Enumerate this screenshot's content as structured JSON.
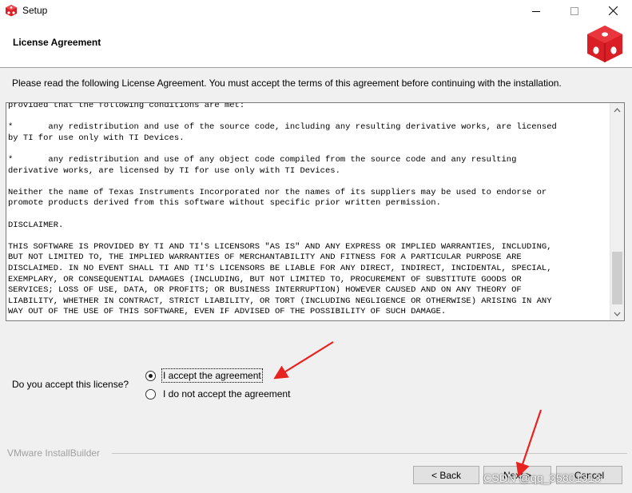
{
  "window": {
    "title": "Setup",
    "controls": {
      "minimize": "minimize-icon",
      "maximize": "maximize-icon",
      "close": "close-icon"
    }
  },
  "header": {
    "title": "License Agreement",
    "logo": "installer-box-logo"
  },
  "instruction": "Please read the following License Agreement. You must accept the terms of this agreement before continuing with the installation.",
  "license": {
    "lines": [
      "provided that the following conditions are met:",
      "",
      "*       any redistribution and use of the source code, including any resulting derivative works, are licensed",
      "by TI for use only with TI Devices.",
      "",
      "*       any redistribution and use of any object code compiled from the source code and any resulting",
      "derivative works, are licensed by TI for use only with TI Devices.",
      "",
      "Neither the name of Texas Instruments Incorporated nor the names of its suppliers may be used to endorse or",
      "promote products derived from this software without specific prior written permission.",
      "",
      "DISCLAIMER.",
      "",
      "THIS SOFTWARE IS PROVIDED BY TI AND TI'S LICENSORS \"AS IS\" AND ANY EXPRESS OR IMPLIED WARRANTIES, INCLUDING,",
      "BUT NOT LIMITED TO, THE IMPLIED WARRANTIES OF MERCHANTABILITY AND FITNESS FOR A PARTICULAR PURPOSE ARE",
      "DISCLAIMED. IN NO EVENT SHALL TI AND TI'S LICENSORS BE LIABLE FOR ANY DIRECT, INDIRECT, INCIDENTAL, SPECIAL,",
      "EXEMPLARY, OR CONSEQUENTIAL DAMAGES (INCLUDING, BUT NOT LIMITED TO, PROCUREMENT OF SUBSTITUTE GOODS OR",
      "SERVICES; LOSS OF USE, DATA, OR PROFITS; OR BUSINESS INTERRUPTION) HOWEVER CAUSED AND ON ANY THEORY OF",
      "LIABILITY, WHETHER IN CONTRACT, STRICT LIABILITY, OR TORT (INCLUDING NEGLIGENCE OR OTHERWISE) ARISING IN ANY",
      "WAY OUT OF THE USE OF THIS SOFTWARE, EVEN IF ADVISED OF THE POSSIBILITY OF SUCH DAMAGE."
    ]
  },
  "question": {
    "label": "Do you accept this license?",
    "options": [
      {
        "label": "I accept the agreement",
        "selected": true
      },
      {
        "label": "I do not accept the agreement",
        "selected": false
      }
    ]
  },
  "brand": "VMware InstallBuilder",
  "buttons": {
    "back": "< Back",
    "next": "Next >",
    "cancel": "Cancel"
  },
  "watermark": "CSDN @qq_35801313",
  "colors": {
    "logo_red": "#d91e25",
    "annotation_red": "#e8231f"
  }
}
